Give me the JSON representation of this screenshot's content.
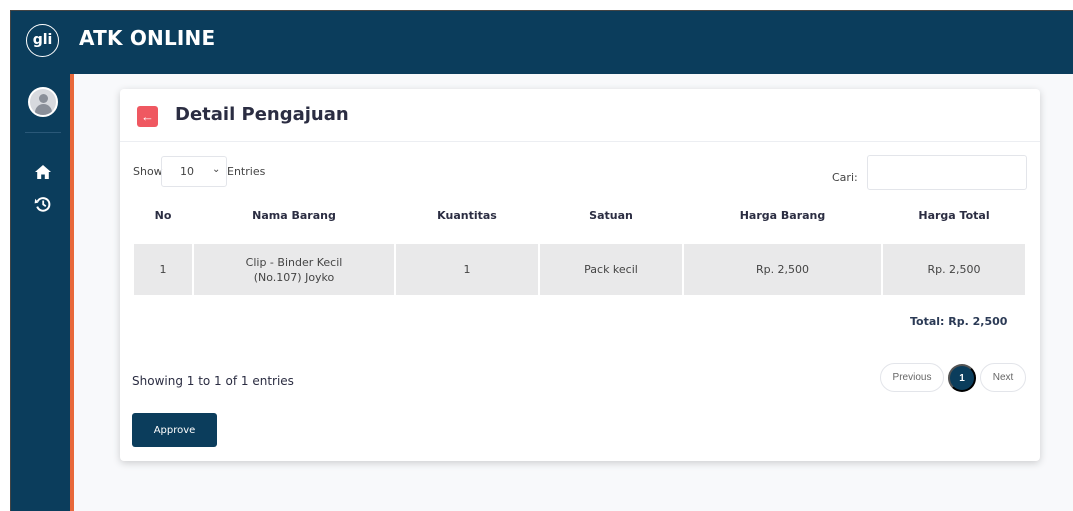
{
  "header": {
    "logo_text": "gli",
    "app_title": "ATK ONLINE"
  },
  "sidebar": {
    "icons": [
      "user-avatar",
      "home-icon",
      "history-icon"
    ]
  },
  "card": {
    "title": "Detail Pengajuan",
    "show_label": "Show",
    "entries_value": "10",
    "entries_label": "Entries",
    "search_label": "Cari:",
    "search_value": "",
    "table": {
      "columns": [
        "No",
        "Nama Barang",
        "Kuantitas",
        "Satuan",
        "Harga Barang",
        "Harga Total"
      ],
      "rows": [
        {
          "no": "1",
          "nama_barang": "Clip - Binder Kecil (No.107) Joyko",
          "kuantitas": "1",
          "satuan": "Pack kecil",
          "harga_barang": "Rp. 2,500",
          "harga_total": "Rp. 2,500"
        }
      ]
    },
    "total": "Total: Rp. 2,500",
    "showing": "Showing 1 to 1 of 1 entries",
    "pagination": {
      "previous": "Previous",
      "current": "1",
      "next": "Next"
    },
    "approve_label": "Approve"
  },
  "colors": {
    "primary": "#0b3d5c",
    "accent": "#e8683a",
    "danger": "#ef5861"
  }
}
